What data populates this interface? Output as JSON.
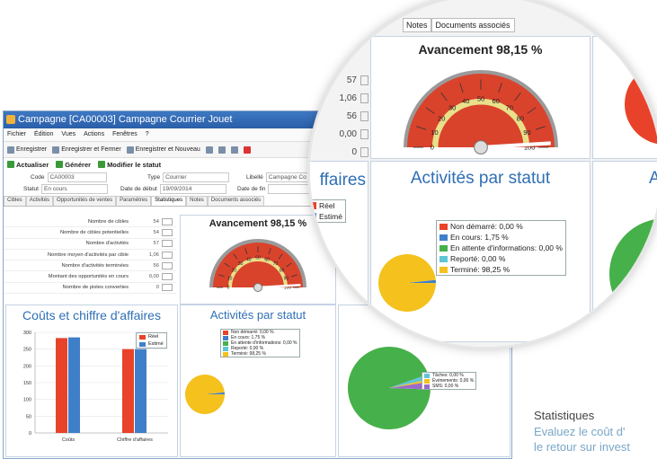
{
  "window": {
    "title": "Campagne [CA00003] Campagne Courrier Jouet",
    "menu": [
      "Fichier",
      "Édition",
      "Vues",
      "Actions",
      "Fenêtres",
      "?"
    ],
    "toolbar": [
      "Enregistrer",
      "Enregistrer et Fermer",
      "Enregistrer et Nouveau"
    ],
    "actions": [
      "Actualiser",
      "Générer",
      "Modifier le statut"
    ]
  },
  "form": {
    "code_label": "Code",
    "code_value": "CA00003",
    "statut_label": "Statut",
    "statut_value": "En cours",
    "type_label": "Type",
    "type_value": "Courrier",
    "date_debut_label": "Date de début",
    "date_debut_value": "19/09/2014",
    "libelle_label": "Libellé",
    "libelle_value": "Campagne Co",
    "date_fin_label": "Date de fin"
  },
  "tabs": [
    "Cibles",
    "Activités",
    "Opportunités de ventes",
    "Paramètres",
    "Statistiques",
    "Notes",
    "Documents associés"
  ],
  "stats": [
    {
      "label": "Nombre de cibles",
      "value": "54"
    },
    {
      "label": "Nombre de cibles potentielles",
      "value": "54"
    },
    {
      "label": "Nombre d'activités",
      "value": "57"
    },
    {
      "label": "Nombre moyen d'activités par cible",
      "value": "1,06"
    },
    {
      "label": "Nombre d'activités terminées",
      "value": "56"
    },
    {
      "label": "Montant des opportunités en cours",
      "value": "0,00"
    },
    {
      "label": "Nombre de pistes converties",
      "value": "0"
    }
  ],
  "gauge": {
    "title": "Avancement 98,15 %",
    "value": 98.15,
    "ticks": [
      "0",
      "10",
      "20",
      "30",
      "40",
      "50",
      "60",
      "70",
      "80",
      "90",
      "100"
    ]
  },
  "costs": {
    "title": "Coûts et chiffre d'affaires",
    "title_zoom": "ffaires",
    "legend": [
      "Réel",
      "Estimé"
    ],
    "colors": [
      "#e8432a",
      "#3f7fc9"
    ]
  },
  "activities": {
    "title": "Activités par statut",
    "legend": [
      "Non démarré: 0,00 %",
      "En cours: 1,75 %",
      "En attente d'informations: 0,00 %",
      "Reporté: 0,00 %",
      "Terminé: 98,25 %"
    ],
    "colors": [
      "#e8432a",
      "#3f7fc9",
      "#46b04a",
      "#5ec6d6",
      "#f4c11d"
    ]
  },
  "types_legend": [
    "Tâches: 0,00 %",
    "Événements: 0,00 %",
    "SMS: 0,00 %"
  ],
  "types_colors": [
    "#5ec6d6",
    "#f4c11d",
    "#9b6bc9"
  ],
  "zoom": {
    "tabs": [
      "Notes",
      "Documents associés"
    ],
    "values": [
      "57",
      "1,06",
      "56",
      "0,00",
      "0"
    ],
    "title_right": "Ac"
  },
  "caption": {
    "title": "Statistiques",
    "line1": "Evaluez le coût d'",
    "line2": "le retour sur invest"
  },
  "chart_data": [
    {
      "type": "bar",
      "title": "Coûts et chiffre d'affaires",
      "categories": [
        "Coûts",
        "Chiffre d'affaires"
      ],
      "series": [
        {
          "name": "Réel",
          "values": [
            283,
            250
          ]
        },
        {
          "name": "Estimé",
          "values": [
            285,
            250
          ]
        }
      ],
      "ylim": [
        0,
        300
      ],
      "yticks": [
        0,
        50,
        100,
        150,
        200,
        250,
        300
      ],
      "grid": true,
      "legend": "top-right"
    },
    {
      "type": "pie",
      "title": "Activités par statut",
      "labels": [
        "Non démarré",
        "En cours",
        "En attente d'informations",
        "Reporté",
        "Terminé"
      ],
      "values": [
        0,
        1.75,
        0,
        0,
        98.25
      ],
      "legend": "top-right"
    }
  ]
}
